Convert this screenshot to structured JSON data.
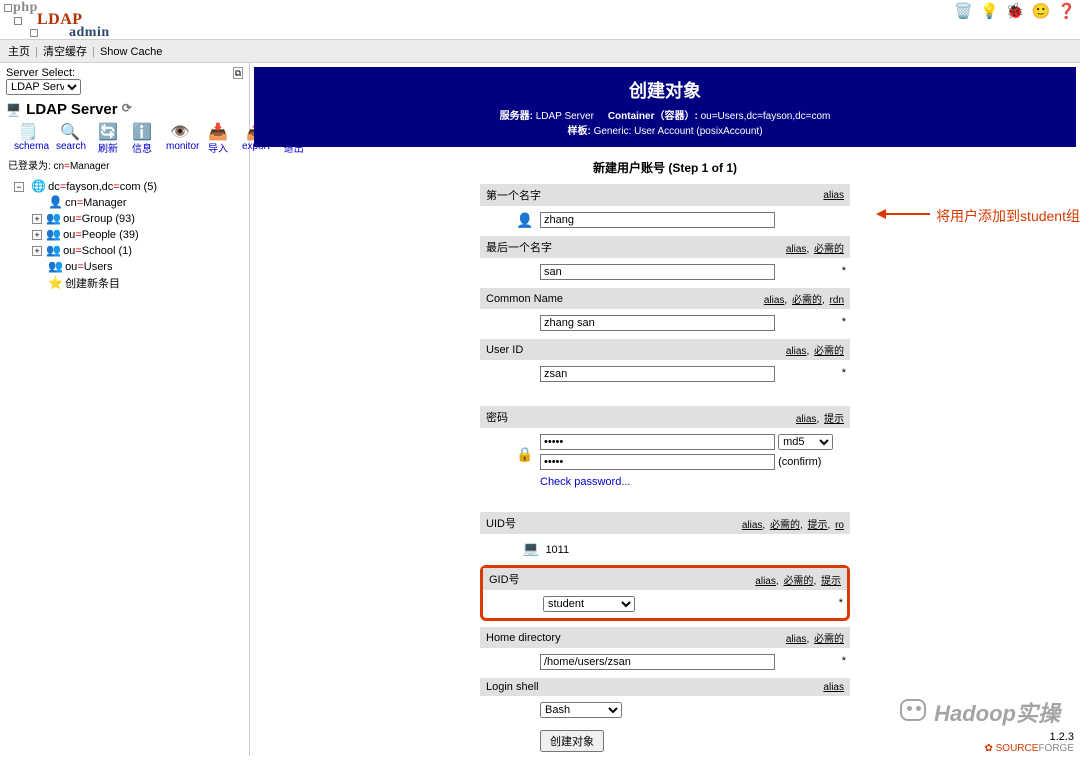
{
  "logo": {
    "line1": "php",
    "line2": "LDAP",
    "line3": "admin"
  },
  "menubar": {
    "home": "主页",
    "clear": "清空缓存",
    "show": "Show Cache"
  },
  "left": {
    "server_select_label": "Server Select:",
    "server_select_value": "LDAP Server",
    "heading": "LDAP Server",
    "logged_as_prefix": "已登录为: cn",
    "logged_as_value": "Manager",
    "tools": {
      "schema": "schema",
      "search": "search",
      "refresh": "刷新",
      "info": "信息",
      "monitor": "monitor",
      "import": "导入",
      "export": "export",
      "logout": "退出"
    },
    "dc_base_label": "dc=fayson,dc=com",
    "dc_count": "5",
    "tree": [
      {
        "attr": "cn",
        "val": "Manager",
        "count": null,
        "expander": null,
        "icon": "👤"
      },
      {
        "attr": "ou",
        "val": "Group",
        "count": "93",
        "expander": "+",
        "icon": "👥"
      },
      {
        "attr": "ou",
        "val": "People",
        "count": "39",
        "expander": "+",
        "icon": "👥"
      },
      {
        "attr": "ou",
        "val": "School",
        "count": "1",
        "expander": "+",
        "icon": "👥"
      },
      {
        "attr": "ou",
        "val": "Users",
        "count": null,
        "expander": null,
        "icon": "👥"
      },
      {
        "attr": null,
        "val": "创建新条目",
        "count": null,
        "expander": null,
        "icon": "⭐"
      }
    ]
  },
  "headerbar": {
    "title": "创建对象",
    "srv_label": "服务器:",
    "srv_value": "LDAP Server",
    "cont_label": "Container（容器）:",
    "cont_value": "ou=Users,dc=fayson,dc=com",
    "tpl_label": "样板:",
    "tpl_value": "Generic: User Account (posixAccount)"
  },
  "step": "新建用户账号 (Step 1 of 1)",
  "labels": {
    "first": "第一个名字",
    "last": "最后一个名字",
    "cn": "Common Name",
    "uid": "User ID",
    "pwd": "密码",
    "uidnum": "UID号",
    "gidnum": "GID号",
    "home": "Home directory",
    "shell": "Login shell"
  },
  "meta": {
    "alias": "alias",
    "required": "必需的",
    "rdn": "rdn",
    "hint": "提示",
    "ro": "ro",
    "confirm": "(confirm)",
    "check": "Check password..."
  },
  "values": {
    "first": "zhang",
    "last": "san",
    "cn": "zhang san",
    "uid": "zsan",
    "pwd": "•••••",
    "pwd2": "•••••",
    "enc": "md5",
    "uidnum": "1011",
    "gid": "student",
    "home": "/home/users/zsan",
    "shell": "Bash"
  },
  "button_create": "创建对象",
  "annotation": "将用户添加到student组",
  "watermark": "Hadoop实操",
  "footer": {
    "version": "1.2.3",
    "sf1": "SOURCE",
    "sf2": "FORGE"
  }
}
